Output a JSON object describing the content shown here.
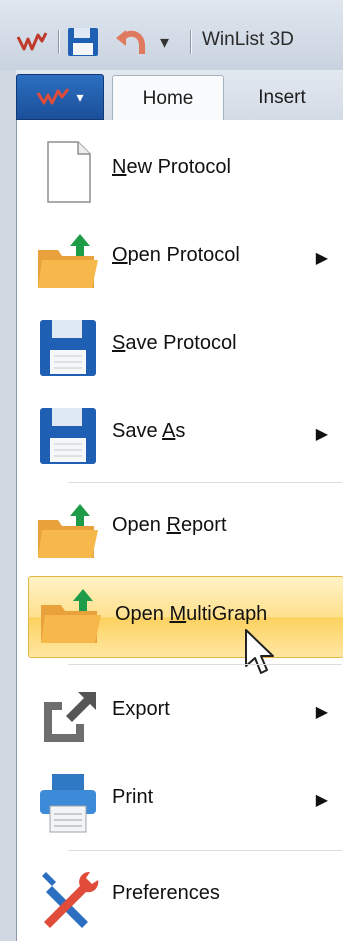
{
  "window": {
    "title": "WinList 3D"
  },
  "tabs": [
    {
      "label": "Home"
    },
    {
      "label": "Insert"
    }
  ],
  "menu": {
    "items": [
      {
        "pre": "",
        "ul": "N",
        "post": "ew Protocol",
        "arrow": ""
      },
      {
        "pre": "",
        "ul": "O",
        "post": "pen Protocol",
        "arrow": "▶"
      },
      {
        "pre": "",
        "ul": "S",
        "post": "ave Protocol",
        "arrow": ""
      },
      {
        "pre": "Save ",
        "ul": "A",
        "post": "s",
        "arrow": "▶"
      },
      {
        "pre": "Open ",
        "ul": "R",
        "post": "eport",
        "arrow": ""
      },
      {
        "pre": "Open ",
        "ul": "M",
        "post": "ultiGraph",
        "arrow": ""
      },
      {
        "pre": "Export",
        "ul": "",
        "post": "",
        "arrow": "▶"
      },
      {
        "pre": "Print",
        "ul": "",
        "post": "",
        "arrow": "▶"
      },
      {
        "pre": "Preferences",
        "ul": "",
        "post": "",
        "arrow": ""
      }
    ]
  },
  "colors": {
    "accent": "#1b4f9a",
    "hover": "#ffe08d",
    "folder": "#f7b84b",
    "green": "#1f9c4a"
  }
}
